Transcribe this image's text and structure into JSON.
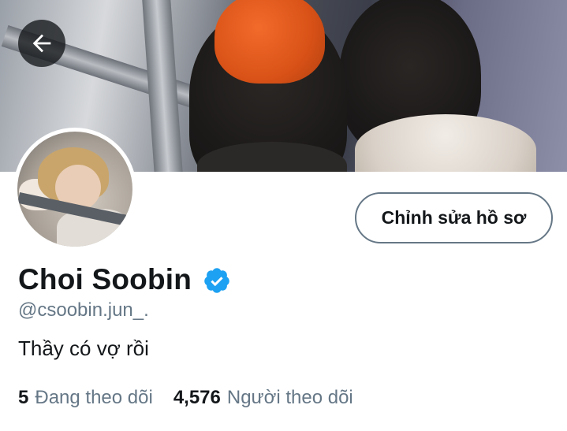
{
  "header": {
    "back_icon": "arrow-left-icon"
  },
  "profile": {
    "display_name": "Choi Soobin",
    "verified_icon": "verified-badge-icon",
    "verified_color": "#1da1f2",
    "handle": "@csoobin.jun_.",
    "bio": "Thầy có vợ rồi",
    "edit_button_label": "Chỉnh sửa hồ sơ"
  },
  "stats": {
    "following_count": "5",
    "following_label": "Đang theo dõi",
    "followers_count": "4,576",
    "followers_label": "Người theo dõi"
  },
  "colors": {
    "text_primary": "#14171a",
    "text_secondary": "#657786",
    "accent": "#1da1f2"
  }
}
